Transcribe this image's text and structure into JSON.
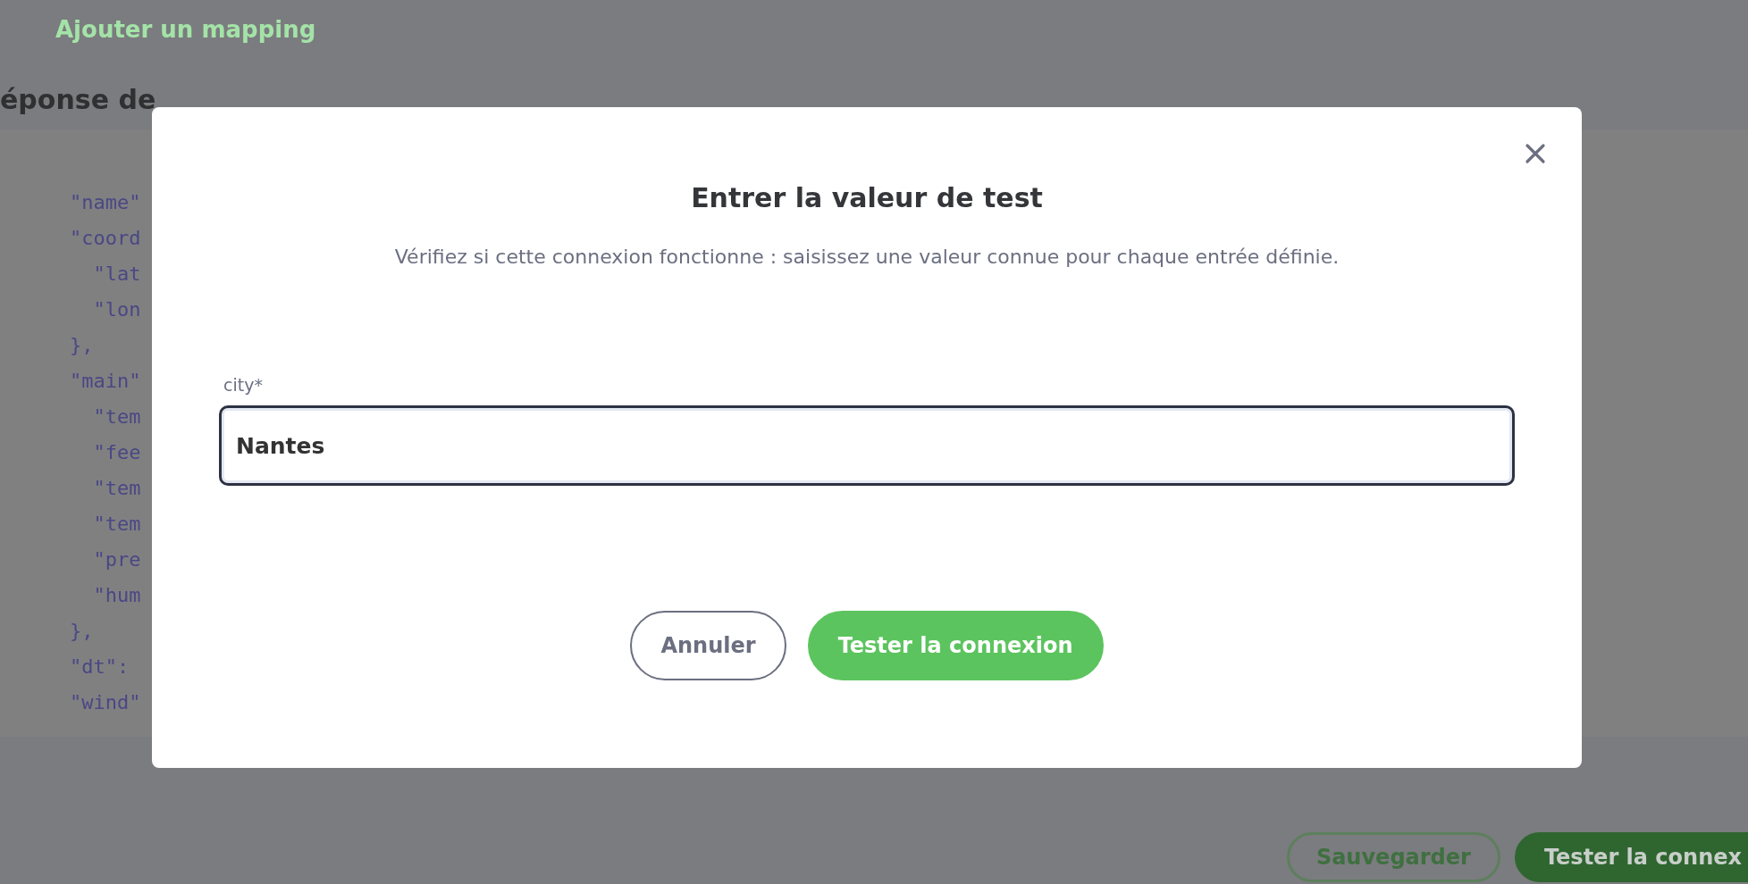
{
  "background": {
    "add_mapping_link": "Ajouter un mapping",
    "section_title": "éponse de",
    "code_lines": [
      "\"name\"",
      "\"coord",
      "  \"lat",
      "  \"lon",
      "},",
      "\"main\"",
      "  \"tem",
      "  \"fee",
      "  \"tem",
      "  \"tem",
      "  \"pre",
      "  \"hum",
      "},",
      "\"dt\":",
      "\"wind\""
    ],
    "buttons": [
      {
        "label": "Sauvegarder",
        "kind": "outline"
      },
      {
        "label": "Tester la connex",
        "kind": "primary"
      }
    ]
  },
  "dialog": {
    "title": "Entrer la valeur de test",
    "description": "Vérifiez si cette connexion fonctionne : saisissez une valeur connue pour chaque entrée définie.",
    "fields": [
      {
        "label": "city*",
        "value": "Nantes"
      }
    ],
    "buttons": [
      {
        "label": "Annuler",
        "kind": "outline"
      },
      {
        "label": "Tester la connexion",
        "kind": "primary"
      }
    ]
  }
}
